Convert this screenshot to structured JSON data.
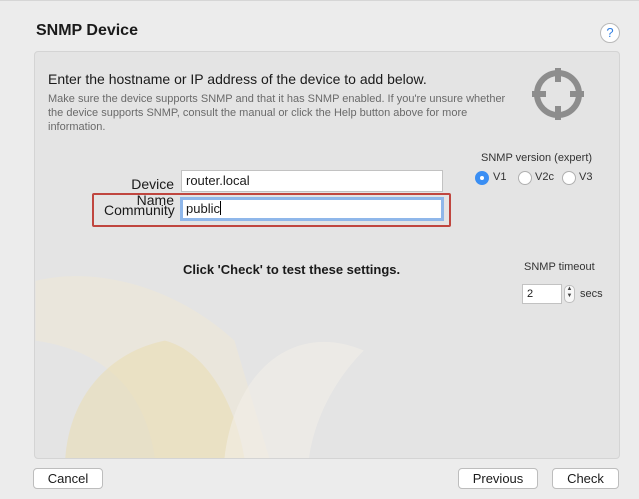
{
  "title": "SNMP Device",
  "help_label": "?",
  "heading": "Enter the hostname or IP address of the device to add below.",
  "description": "Make sure the device supports SNMP and that it has SNMP enabled. If you're unsure whether the device supports SNMP, consult the manual or click the Help button above for more information.",
  "form": {
    "device_name_label": "Device Name",
    "device_name_value": "router.local",
    "community_label": "Community",
    "community_value": "public"
  },
  "snmp_version": {
    "label": "SNMP version (expert)",
    "options": [
      "V1",
      "V2c",
      "V3"
    ],
    "selected": "V1"
  },
  "check_message": "Click 'Check' to test these settings.",
  "timeout": {
    "label": "SNMP timeout",
    "value": "2",
    "unit": "secs"
  },
  "buttons": {
    "cancel": "Cancel",
    "previous": "Previous",
    "check": "Check"
  },
  "icons": {
    "help": "help-icon",
    "target": "crosshair-icon",
    "stepper": "stepper-icon"
  },
  "colors": {
    "accent": "#3a8ef3",
    "highlight": "#c0463f",
    "focus_ring": "#8fb7ea"
  }
}
